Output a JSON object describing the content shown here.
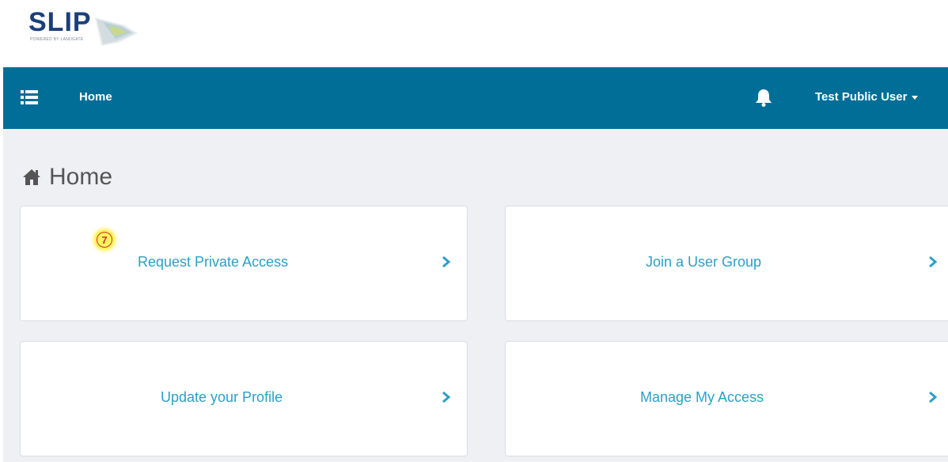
{
  "logo": {
    "text": "SLIP",
    "subtitle": "POWERED BY LANDGATE"
  },
  "navbar": {
    "menu_icon": "list-icon",
    "home_label": "Home",
    "bell_icon": "bell-icon",
    "user_name": "Test Public User",
    "background_color": "#006e96"
  },
  "page": {
    "title": "Home",
    "title_icon": "home-icon"
  },
  "cards": [
    {
      "label": "Request Private Access"
    },
    {
      "label": "Join a User Group"
    },
    {
      "label": "Update your Profile"
    },
    {
      "label": "Manage My Access"
    }
  ],
  "annotation": {
    "marker_label": "7"
  },
  "colors": {
    "link": "#2b9fc7",
    "content_bg": "#eef0f4",
    "marker": "#fff35c"
  }
}
